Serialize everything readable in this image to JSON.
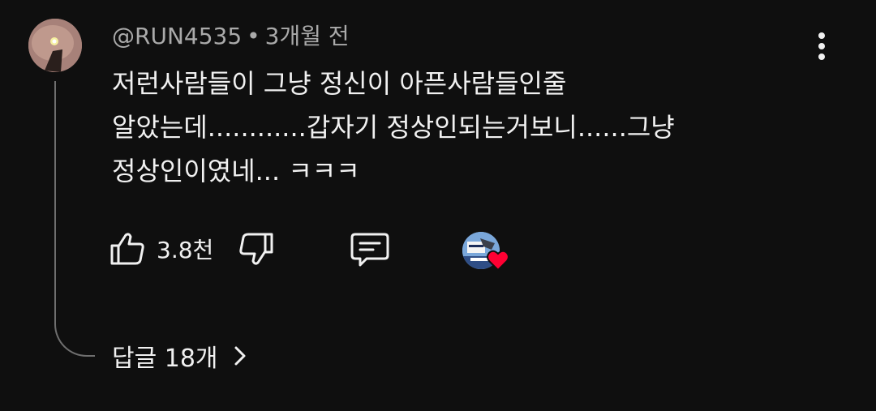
{
  "comment": {
    "author": "@RUN4535",
    "separator": "•",
    "timestamp": "3개월 전",
    "lines": [
      "저런사람들이 그냥 정신이 아픈사람들인줄",
      "알았는데............갑자기 정상인되는거보니......그냥",
      "정상인이였네... ㅋㅋㅋ"
    ]
  },
  "actions": {
    "like_count": "3.8천",
    "like_icon": "thumbs-up-icon",
    "dislike_icon": "thumbs-down-icon",
    "reply_icon": "comment-icon",
    "creator_heart": "creator-heart-icon"
  },
  "replies": {
    "label": "답글 18개"
  },
  "colors": {
    "background": "#0f0f0f",
    "text_primary": "#f1f1f1",
    "text_secondary": "#aaaaaa",
    "heart": "#ff0033",
    "thread_line": "#6f6f6f"
  }
}
